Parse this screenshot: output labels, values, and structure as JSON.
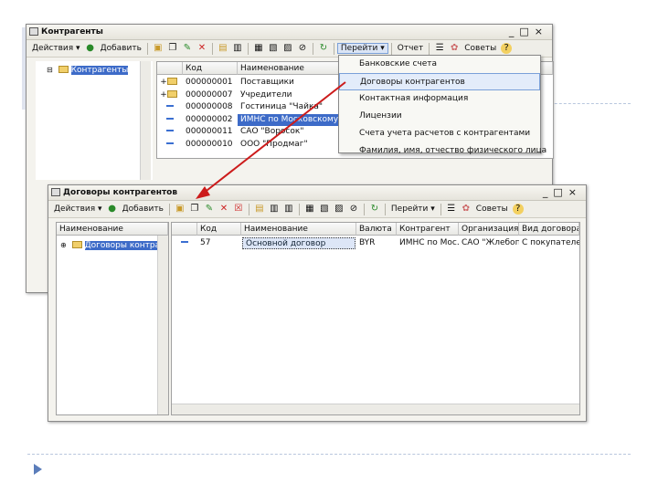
{
  "slide": {
    "bullet_icon": "triangle-bullet-icon",
    "colors": {
      "accent": "#5b7dba",
      "divider": "#b9c7de",
      "arrow": "#cc1b1b",
      "selection": "#3d6bc8"
    }
  },
  "win1": {
    "title": "Контрагенты",
    "toolbar": {
      "actions": "Действия",
      "add": "Добавить",
      "goto": "Перейти",
      "report": "Отчет",
      "tips": "Советы"
    },
    "tree": {
      "root": "Контрагенты"
    },
    "columns": {
      "code": "Код",
      "name": "Наименование"
    },
    "rows": [
      {
        "marker": "+",
        "icon": "folder",
        "code": "000000001",
        "name": "Поставщики"
      },
      {
        "marker": "+",
        "icon": "folder",
        "code": "000000007",
        "name": "Учредители"
      },
      {
        "marker": "",
        "icon": "dash",
        "code": "000000008",
        "name": "Гостиница \"Чайка\""
      },
      {
        "marker": "",
        "icon": "dash",
        "code": "000000002",
        "name": "ИМНС по Московскому району"
      },
      {
        "marker": "",
        "icon": "dash",
        "code": "000000011",
        "name": "САО \"Воросок\""
      },
      {
        "marker": "",
        "icon": "dash",
        "code": "000000010",
        "name": "ООО \"Продмаг\""
      }
    ],
    "menu": [
      "Банковские счета",
      "Договоры контрагентов",
      "Контактная информация",
      "Лицензии",
      "Счета учета расчетов с контрагентами",
      "Фамилия, имя, отчество физического лица"
    ]
  },
  "win2": {
    "title": "Договоры контрагентов",
    "toolbar": {
      "actions": "Действия",
      "add": "Добавить",
      "goto": "Перейти",
      "tips": "Советы"
    },
    "tree": {
      "header": "Наименование",
      "root": "Договоры контрагентов"
    },
    "columns": {
      "code": "Код",
      "name": "Наименование",
      "currency": "Валюта",
      "counterparty": "Контрагент",
      "organization": "Организация",
      "type": "Вид договора"
    },
    "row": {
      "code": "57",
      "name": "Основной договор",
      "currency": "BYR",
      "counterparty": "ИМНС по Мос...",
      "organization": "САО \"Жлебоп...",
      "type": "С покупателе"
    }
  }
}
